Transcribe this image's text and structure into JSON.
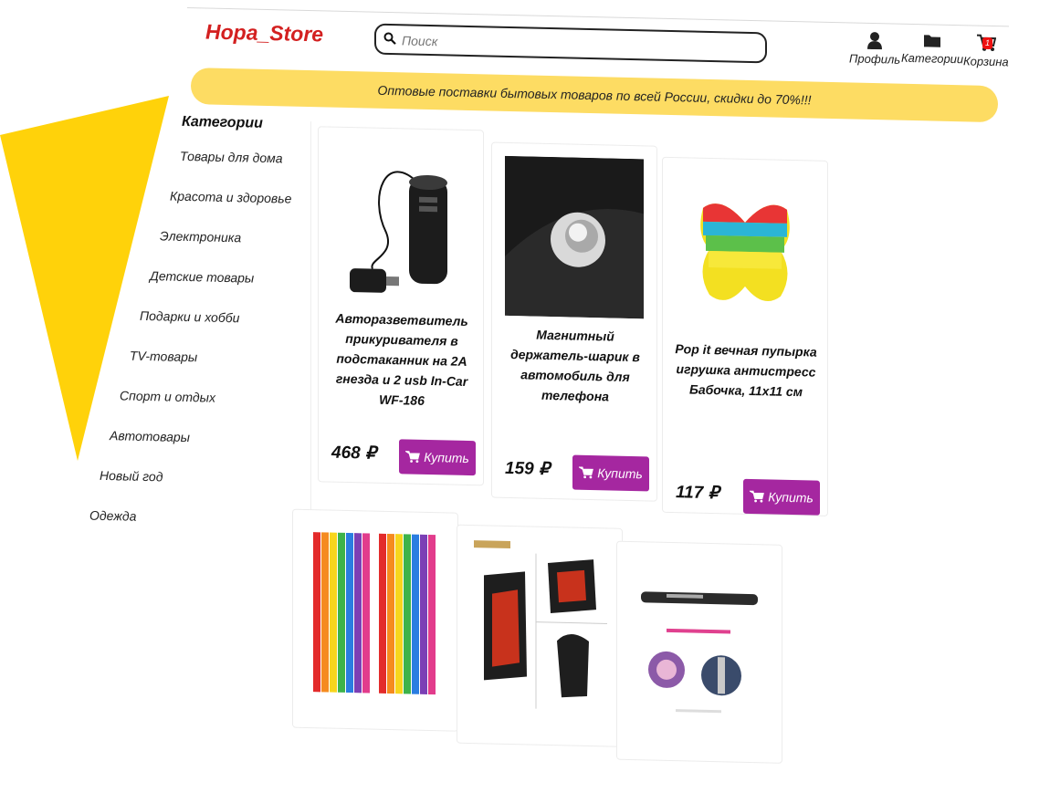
{
  "header": {
    "logo": "Hopa_Store",
    "search_placeholder": "Поиск",
    "nav": [
      {
        "label": "Профиль",
        "icon": "user-icon"
      },
      {
        "label": "Категории",
        "icon": "folder-icon"
      },
      {
        "label": "Корзина",
        "icon": "cart-icon",
        "badge": "1"
      }
    ]
  },
  "banner": "Оптовые поставки бытовых товаров по всей России, скидки до 70%!!!",
  "sidebar": {
    "title": "Категории",
    "items": [
      "Товары для дома",
      "Красота и здоровье",
      "Электроника",
      "Детские товары",
      "Подарки и хобби",
      "TV-товары",
      "Спорт и отдых",
      "Автотовары",
      "Новый год",
      "Одежда"
    ]
  },
  "products": [
    {
      "title": "Авторазветвитель прикуривателя в подстаканник на 2А гнезда и 2 usb In-Car WF-186",
      "price": "468 ₽",
      "buy_label": "Купить",
      "image": "car-socket-splitter"
    },
    {
      "title": "Магнитный держатель-шарик в автомобиль для телефона",
      "price": "159 ₽",
      "buy_label": "Купить",
      "image": "magnetic-phone-holder"
    },
    {
      "title": "Pop it вечная пупырка игрушка антистресс Бабочка, 11x11 см",
      "price": "117 ₽",
      "buy_label": "Купить",
      "image": "pop-it-butterfly"
    },
    {
      "image": "colored-ribbons"
    },
    {
      "image": "bike-phone-mount"
    },
    {
      "image": "led-pen-light"
    }
  ],
  "colors": {
    "accent": "#a527a0",
    "banner": "#fddc63",
    "logo": "#d32020",
    "decor": "#ffd20a"
  }
}
